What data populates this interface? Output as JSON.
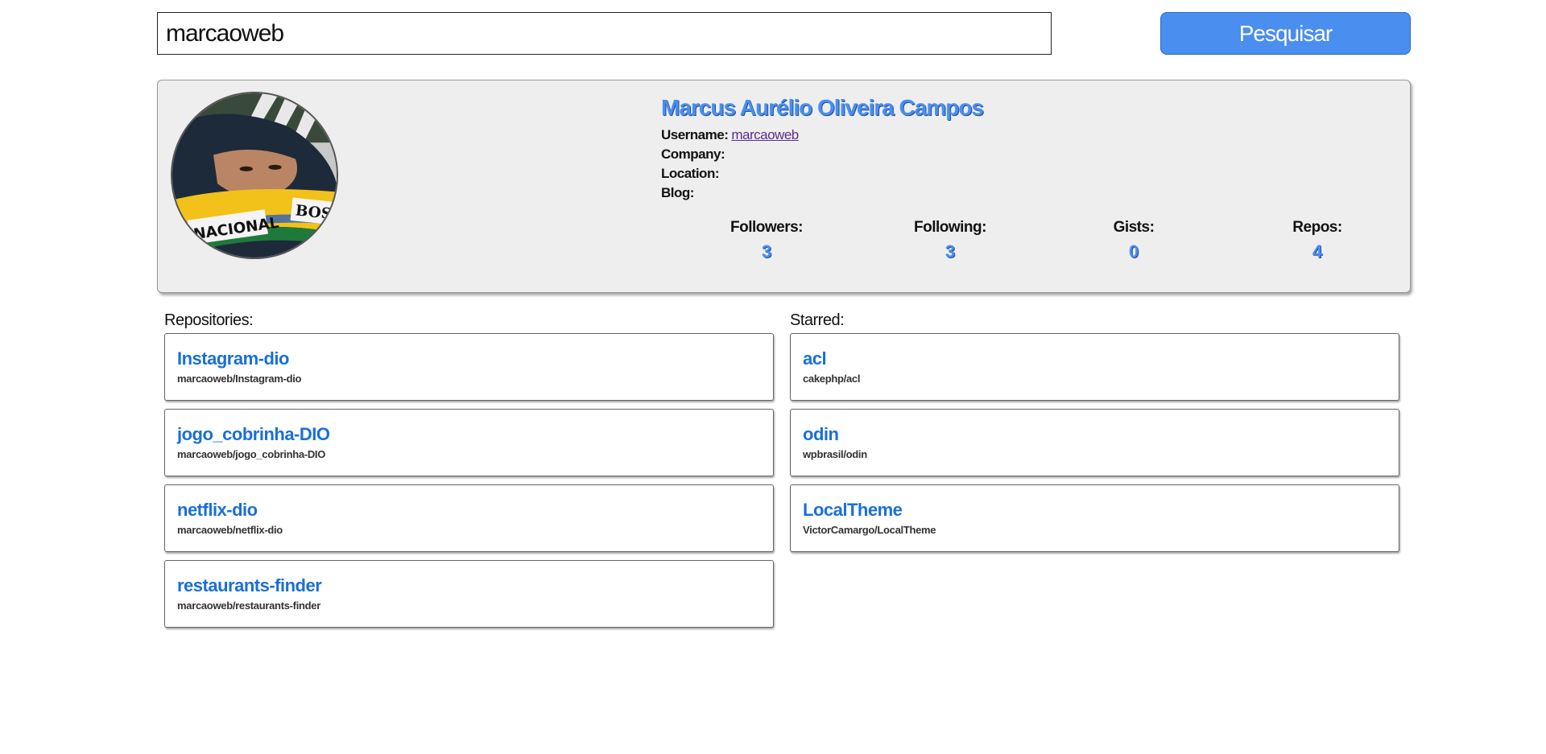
{
  "search": {
    "value": "marcaoweb",
    "button_label": "Pesquisar"
  },
  "profile": {
    "name": "Marcus Aurélio Oliveira Campos",
    "username_label": "Username:",
    "username": "marcaoweb",
    "company_label": "Company:",
    "company": "",
    "location_label": "Location:",
    "location": "",
    "blog_label": "Blog:",
    "blog": "",
    "stats": [
      {
        "label": "Followers:",
        "value": "3"
      },
      {
        "label": "Following:",
        "value": "3"
      },
      {
        "label": "Gists:",
        "value": "0"
      },
      {
        "label": "Repos:",
        "value": "4"
      }
    ]
  },
  "repositories": {
    "title": "Repositories:",
    "items": [
      {
        "name": "Instagram-dio",
        "full_name": "marcaoweb/Instagram-dio"
      },
      {
        "name": "jogo_cobrinha-DIO",
        "full_name": "marcaoweb/jogo_cobrinha-DIO"
      },
      {
        "name": "netflix-dio",
        "full_name": "marcaoweb/netflix-dio"
      },
      {
        "name": "restaurants-finder",
        "full_name": "marcaoweb/restaurants-finder"
      }
    ]
  },
  "starred": {
    "title": "Starred:",
    "items": [
      {
        "name": "acl",
        "full_name": "cakephp/acl"
      },
      {
        "name": "odin",
        "full_name": "wpbrasil/odin"
      },
      {
        "name": "LocalTheme",
        "full_name": "VictorCamargo/LocalTheme"
      }
    ]
  },
  "avatar_badge_text": "NACIONAL",
  "avatar_brand_text": "BOSS",
  "colors": {
    "accent": "#4a8ef0",
    "link": "#1a6fd6",
    "card_bg": "#eeeeee"
  }
}
